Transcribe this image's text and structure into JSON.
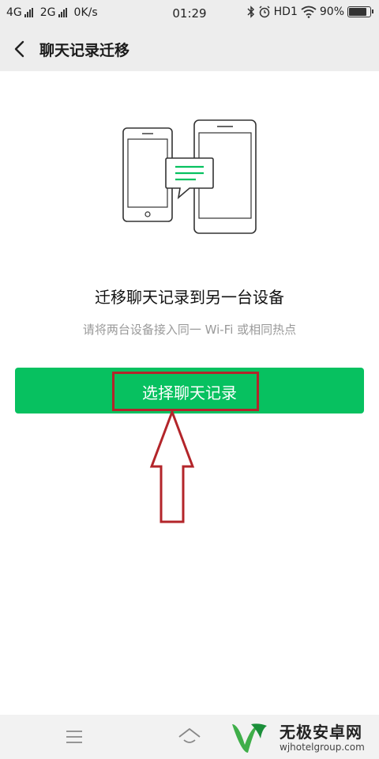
{
  "status_bar": {
    "network1": "4G",
    "network2": "2G",
    "speed": "0K/s",
    "time": "01:29",
    "hd": "HD1",
    "battery_text": "90%",
    "battery_level": 0.9
  },
  "header": {
    "title": "聊天记录迁移"
  },
  "main": {
    "title": "迁移聊天记录到另一台设备",
    "subtitle": "请将两台设备接入同一 Wi-Fi 或相同热点",
    "button_label": "选择聊天记录"
  },
  "colors": {
    "accent": "#07c160",
    "annotation": "#b3252a"
  },
  "watermark": {
    "name": "无极安卓网",
    "url": "wjhotelgroup.com"
  },
  "icons": [
    "back-arrow",
    "bluetooth",
    "alarm",
    "wifi",
    "battery",
    "menu",
    "home"
  ]
}
